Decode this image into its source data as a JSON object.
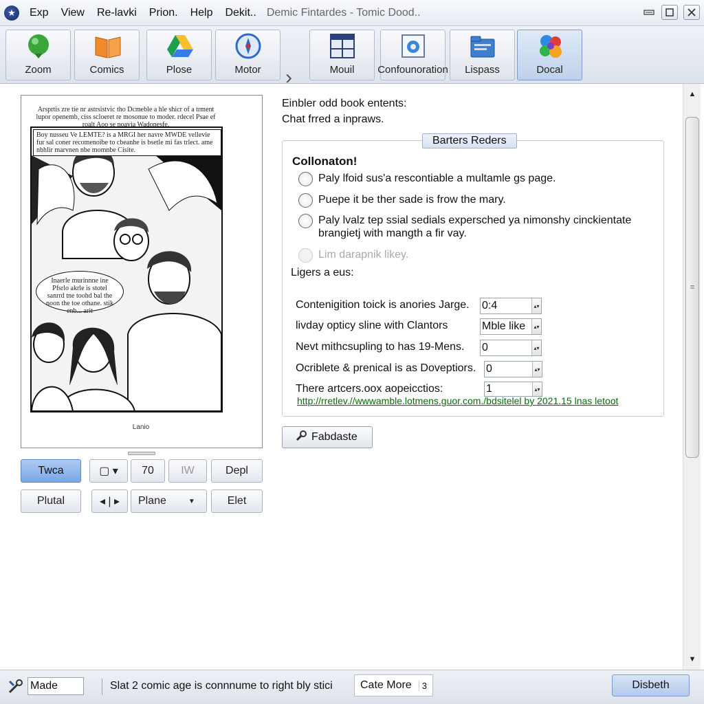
{
  "menubar": {
    "items": [
      "Exp",
      "View",
      "Re-lavki",
      "Prion.",
      "Help",
      "Dekit.."
    ],
    "title": "Demic Fintardes  -  Tomic Dood.."
  },
  "toolbar": {
    "buttons": [
      {
        "label": "Zoom",
        "icon": "green-globe-icon"
      },
      {
        "label": "Comics",
        "icon": "orange-book-icon"
      },
      {
        "label": "Plose",
        "icon": "drive-triangle-icon"
      },
      {
        "label": "Motor",
        "icon": "compass-icon"
      },
      {
        "label": "Mouil",
        "icon": "grid-window-icon"
      },
      {
        "label": "Confounoration",
        "icon": "settings-window-icon"
      },
      {
        "label": "Lispass",
        "icon": "blue-folder-icon"
      },
      {
        "label": "Docal",
        "icon": "puzzle-pieces-icon"
      }
    ],
    "active": "Docal"
  },
  "comic": {
    "header": "Arsprtis zre tie nr astrsistvic tho Dcmeble a hle shicr of a trment lupor openemb, ciss scloeret re mosonue to moder. rdecel Psae ef roalt Aoo se noavia Wadonesfe.",
    "caption": "Boy nusseu Ve LEMTE? is a MRGI her navre MWDE vellevie fur sal coner recomenoibe to cbeanhe is bsetle mi fas trlect. ame nbhlir marvnen nbe momnbe Cisite.",
    "bubble": "Inaerle murinnne ine Pfsrlo akrle is stotel sanrrd tne toohd bal the noon the toe othane. stik enb... arit",
    "footer": "Lanio"
  },
  "left_controls": {
    "row1": [
      "Twca",
      "▢ ▾",
      "70",
      "IW",
      "Depl"
    ],
    "row2": [
      "Plutal",
      "◂ | ▸",
      "Plane",
      "Elet"
    ]
  },
  "right": {
    "intro1": "Einbler odd book entents:",
    "intro2": "Chat frred a inpraws.",
    "group_title": "Barters Reders",
    "section_title": "Collonaton!",
    "radios": [
      "Paly lfoid sus'a rescontiable a multamle gs page.",
      "Puepe it be ther sade is frow the mary.",
      "Paly lvalz tep ssial sedials expersched ya nimonshy cinckientate brangietj with mangth a fir vay.",
      "Lim darapnik likey."
    ],
    "layers_label": "Ligers a eus:",
    "fields": [
      {
        "label": "Contenigition toick is anories Jarge.",
        "value": "0:4"
      },
      {
        "label": "livday opticy sline with Clantors",
        "value": "Mble like"
      },
      {
        "label": "Nevt mithcsupling to has 19-Mens.",
        "value": "0"
      },
      {
        "label": "Ocriblete & prenical is as Doveptiors.",
        "value": "0"
      },
      {
        "label": "There artcers.oox aopeicctios:",
        "value": "1"
      }
    ],
    "link": "http://rretlev.//wwwamble.lotmens.guor.com./bdsitelel by 2021.15 lnas letoot",
    "button": "Fabdaste"
  },
  "statusbar": {
    "field": "Made",
    "text": "Slat 2 comic age is connnume to right bly stici",
    "cate_label": "Cate More",
    "cate_num": "3",
    "right_button": "Disbeth"
  }
}
